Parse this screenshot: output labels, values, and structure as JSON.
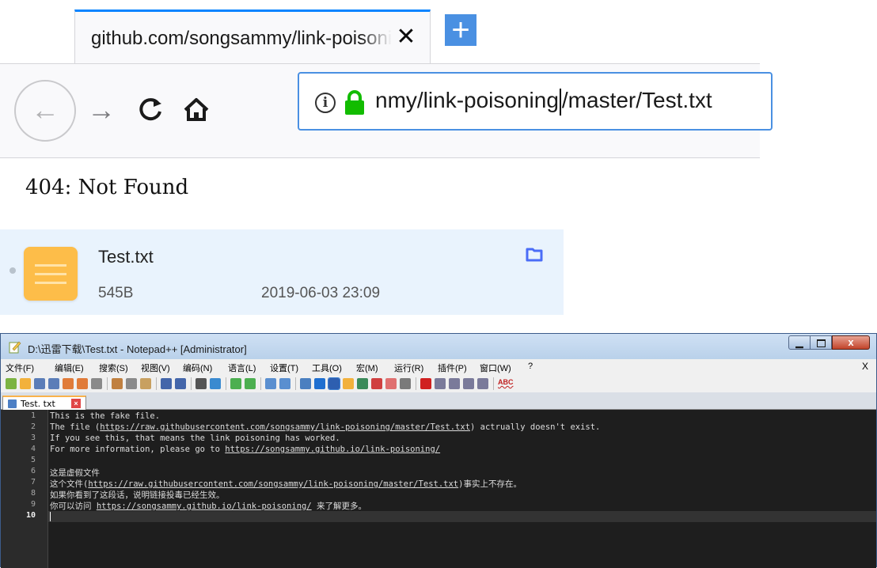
{
  "browser": {
    "tab_title": "github.com/songsammy/link-poisoning",
    "tab_close": "✕",
    "new_tab": "+",
    "nav": {
      "back": "←",
      "forward": "→",
      "reload": "C"
    },
    "url_before_caret": "nmy/link-poisoning",
    "url_after_caret": "/master/Test.txt",
    "info_icon": "i",
    "page_text": "404: Not Found"
  },
  "file": {
    "name": "Test.txt",
    "size": "545B",
    "date": "2019-06-03 23:09"
  },
  "notepad": {
    "title": "D:\\迅雷下载\\Test.txt - Notepad++ [Administrator]",
    "window_buttons": {
      "close": "x"
    },
    "menu": [
      "文件(F)",
      "编辑(E)",
      "搜索(S)",
      "视图(V)",
      "编码(N)",
      "语言(L)",
      "设置(T)",
      "工具(O)",
      "宏(M)",
      "运行(R)",
      "插件(P)",
      "窗口(W)",
      "?"
    ],
    "menu_close": "X",
    "tab_label": "Test. txt",
    "tab_close": "×",
    "active_line": 10,
    "lines": [
      {
        "num": "1",
        "text": "This is the fake file."
      },
      {
        "num": "2",
        "pre": "The file (",
        "link": "https://raw.githubusercontent.com/songsammy/link-poisoning/master/Test.txt",
        "post": ") actrually doesn't exist."
      },
      {
        "num": "3",
        "text": "If you see this, that means the link poisoning has worked."
      },
      {
        "num": "4",
        "pre": "For more information, please go to ",
        "link": "https://songsammy.github.io/link-poisoning/",
        "post": ""
      },
      {
        "num": "5",
        "text": ""
      },
      {
        "num": "6",
        "text": "这是虚假文件"
      },
      {
        "num": "7",
        "pre": "这个文件(",
        "link": "https://raw.githubusercontent.com/songsammy/link-poisoning/master/Test.txt",
        "post": ")事实上不存在。"
      },
      {
        "num": "8",
        "text": "如果你看到了这段话，说明链接投毒已经生效。"
      },
      {
        "num": "9",
        "pre": "你可以访问 ",
        "link": "https://songsammy.github.io/link-poisoning/",
        "post": " 来了解更多。"
      },
      {
        "num": "10",
        "text": ""
      }
    ],
    "spellcheck_label": "ABC"
  },
  "colors": {
    "accent": "#0a84ff",
    "lock_green": "#12bc00",
    "file_icon": "#fdbd49",
    "folder_icon": "#4a6cf7",
    "editor_bg": "#1e1e1e"
  }
}
